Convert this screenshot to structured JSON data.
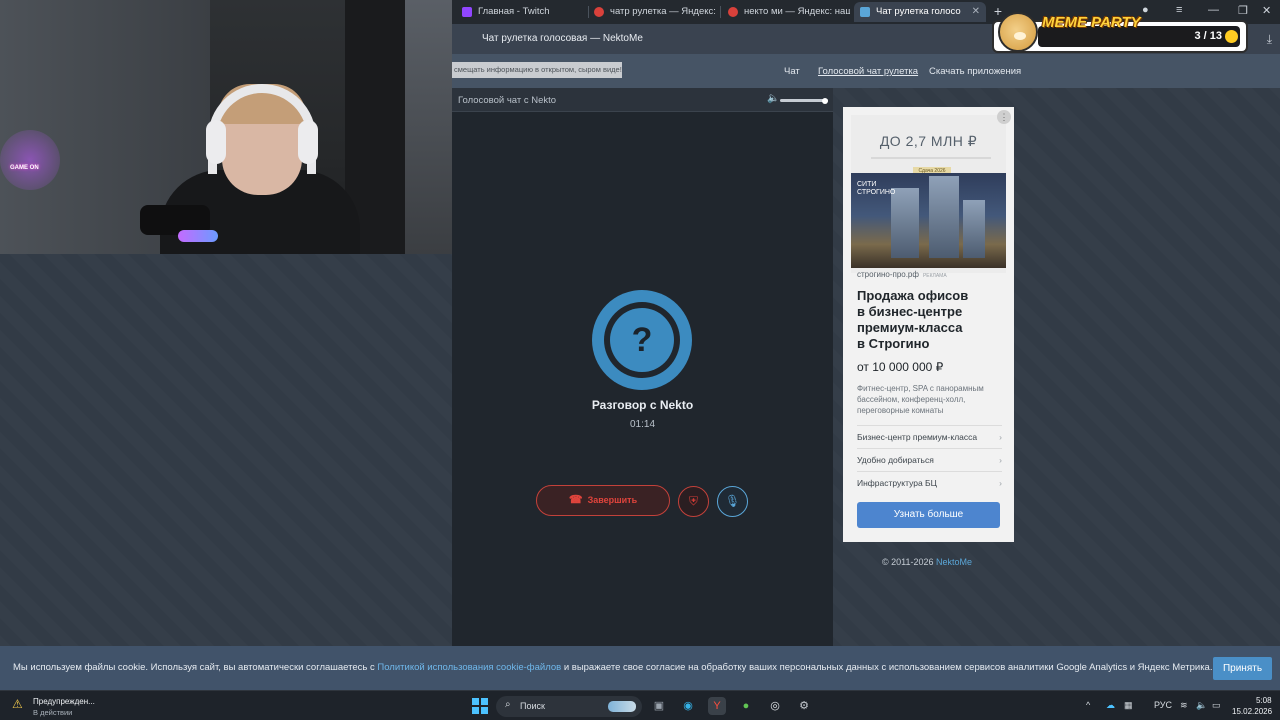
{
  "browser": {
    "tabs": [
      {
        "label": "Главная - Twitch",
        "favicon_color": "#9146ff"
      },
      {
        "label": "чатр рулетка — Яндекс: н",
        "favicon_color": "#d9413b"
      },
      {
        "label": "некто ми — Яндекс: нашл",
        "favicon_color": "#d9413b"
      },
      {
        "label": "Чат рулетка голосо",
        "favicon_color": "#5aa6d8",
        "active": true
      }
    ],
    "new_tab_symbol": "+",
    "page_title": "Чат рулетка голосовая — NektoMe",
    "download_icon": "download-icon"
  },
  "overlay": {
    "brand": "MEME PARTY",
    "counter": "3 / 13"
  },
  "site": {
    "notice": "смещать информацию в открытом, сыром виде!",
    "nav": [
      {
        "label": "Чат",
        "current": false
      },
      {
        "label": "Голосовой чат рулетка",
        "current": true
      },
      {
        "label": "Скачать приложения",
        "current": false
      }
    ],
    "volume_level": 1.0
  },
  "chat": {
    "header_title": "Голосовой чат с Nekto",
    "avatar_glyph": "?",
    "partner_name": "Разговор с Nekto",
    "timer": "01:14",
    "end_label": "Завершить",
    "end_icon": "phone-hangup-icon",
    "shield_icon": "shield-icon",
    "mic_icon": "microphone-icon"
  },
  "ad": {
    "banner_headline": "ДО 2,7 МЛН ₽",
    "banner_tag": "Сдача 2026",
    "photo_label": "СИТИ\nСТРОГИНО",
    "domain": "строгино-про.рф",
    "domain_mark": "РЕКЛАМА",
    "title": "Продажа офисов\nв бизнес-центре\nпремиум-класса\nв Строгино",
    "price": "от 10 000 000 ₽",
    "description": "Фитнес-центр, SPA с панорамным\nбассейном, конференц-холл,\nпереговорные комнаты",
    "items": [
      "Бизнес-центр премиум-класса",
      "Удобно добираться",
      "Инфраструктура БЦ"
    ],
    "cta": "Узнать больше"
  },
  "footer": {
    "copyright_prefix": "© 2011-2026 ",
    "brand": "NektoMe"
  },
  "cookie": {
    "text_before": "Мы используем файлы cookie. Используя сайт, вы автоматически соглашаетесь с ",
    "policy_link": "Политикой использования cookie-файлов",
    "text_after": " и выражаете свое согласие на обработку ваших персональных данных с использованием сервисов аналитики Google Analytics и Яндекс Метрика.",
    "accept": "Принять"
  },
  "webcam": {
    "sign": "GAME ON"
  },
  "taskbar": {
    "warning_title": "Предупрежден...",
    "warning_subtitle": "В действии",
    "search_label": "Поиск",
    "lang": "РУС",
    "time": "5:08",
    "date": "15.02.2026"
  }
}
